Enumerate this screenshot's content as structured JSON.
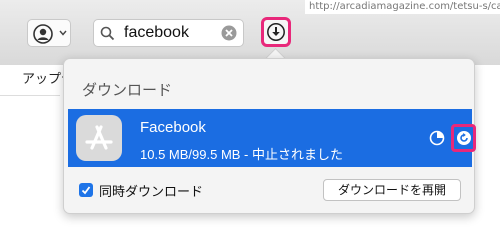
{
  "toolbar": {
    "url_text": "http://arcadiamagazine.com/tetsu-s/cal.ics",
    "search_value": "facebook",
    "account_icon": "person-circle-icon",
    "download_icon": "download-arrow-icon"
  },
  "sidebar": {
    "tab_label": "アップデ"
  },
  "downloads_popover": {
    "title": "ダウンロード",
    "item": {
      "name": "Facebook",
      "status": "10.5 MB/99.5 MB - 中止されました",
      "icon": "app-store-icon"
    },
    "simultaneous_checkbox": {
      "label": "同時ダウンロード",
      "checked": true
    },
    "resume_all_button": "ダウンロードを再開"
  },
  "colors": {
    "row_selected": "#1b6de2",
    "highlight_box": "#e8287a",
    "checkbox_accent": "#1e74e8"
  }
}
